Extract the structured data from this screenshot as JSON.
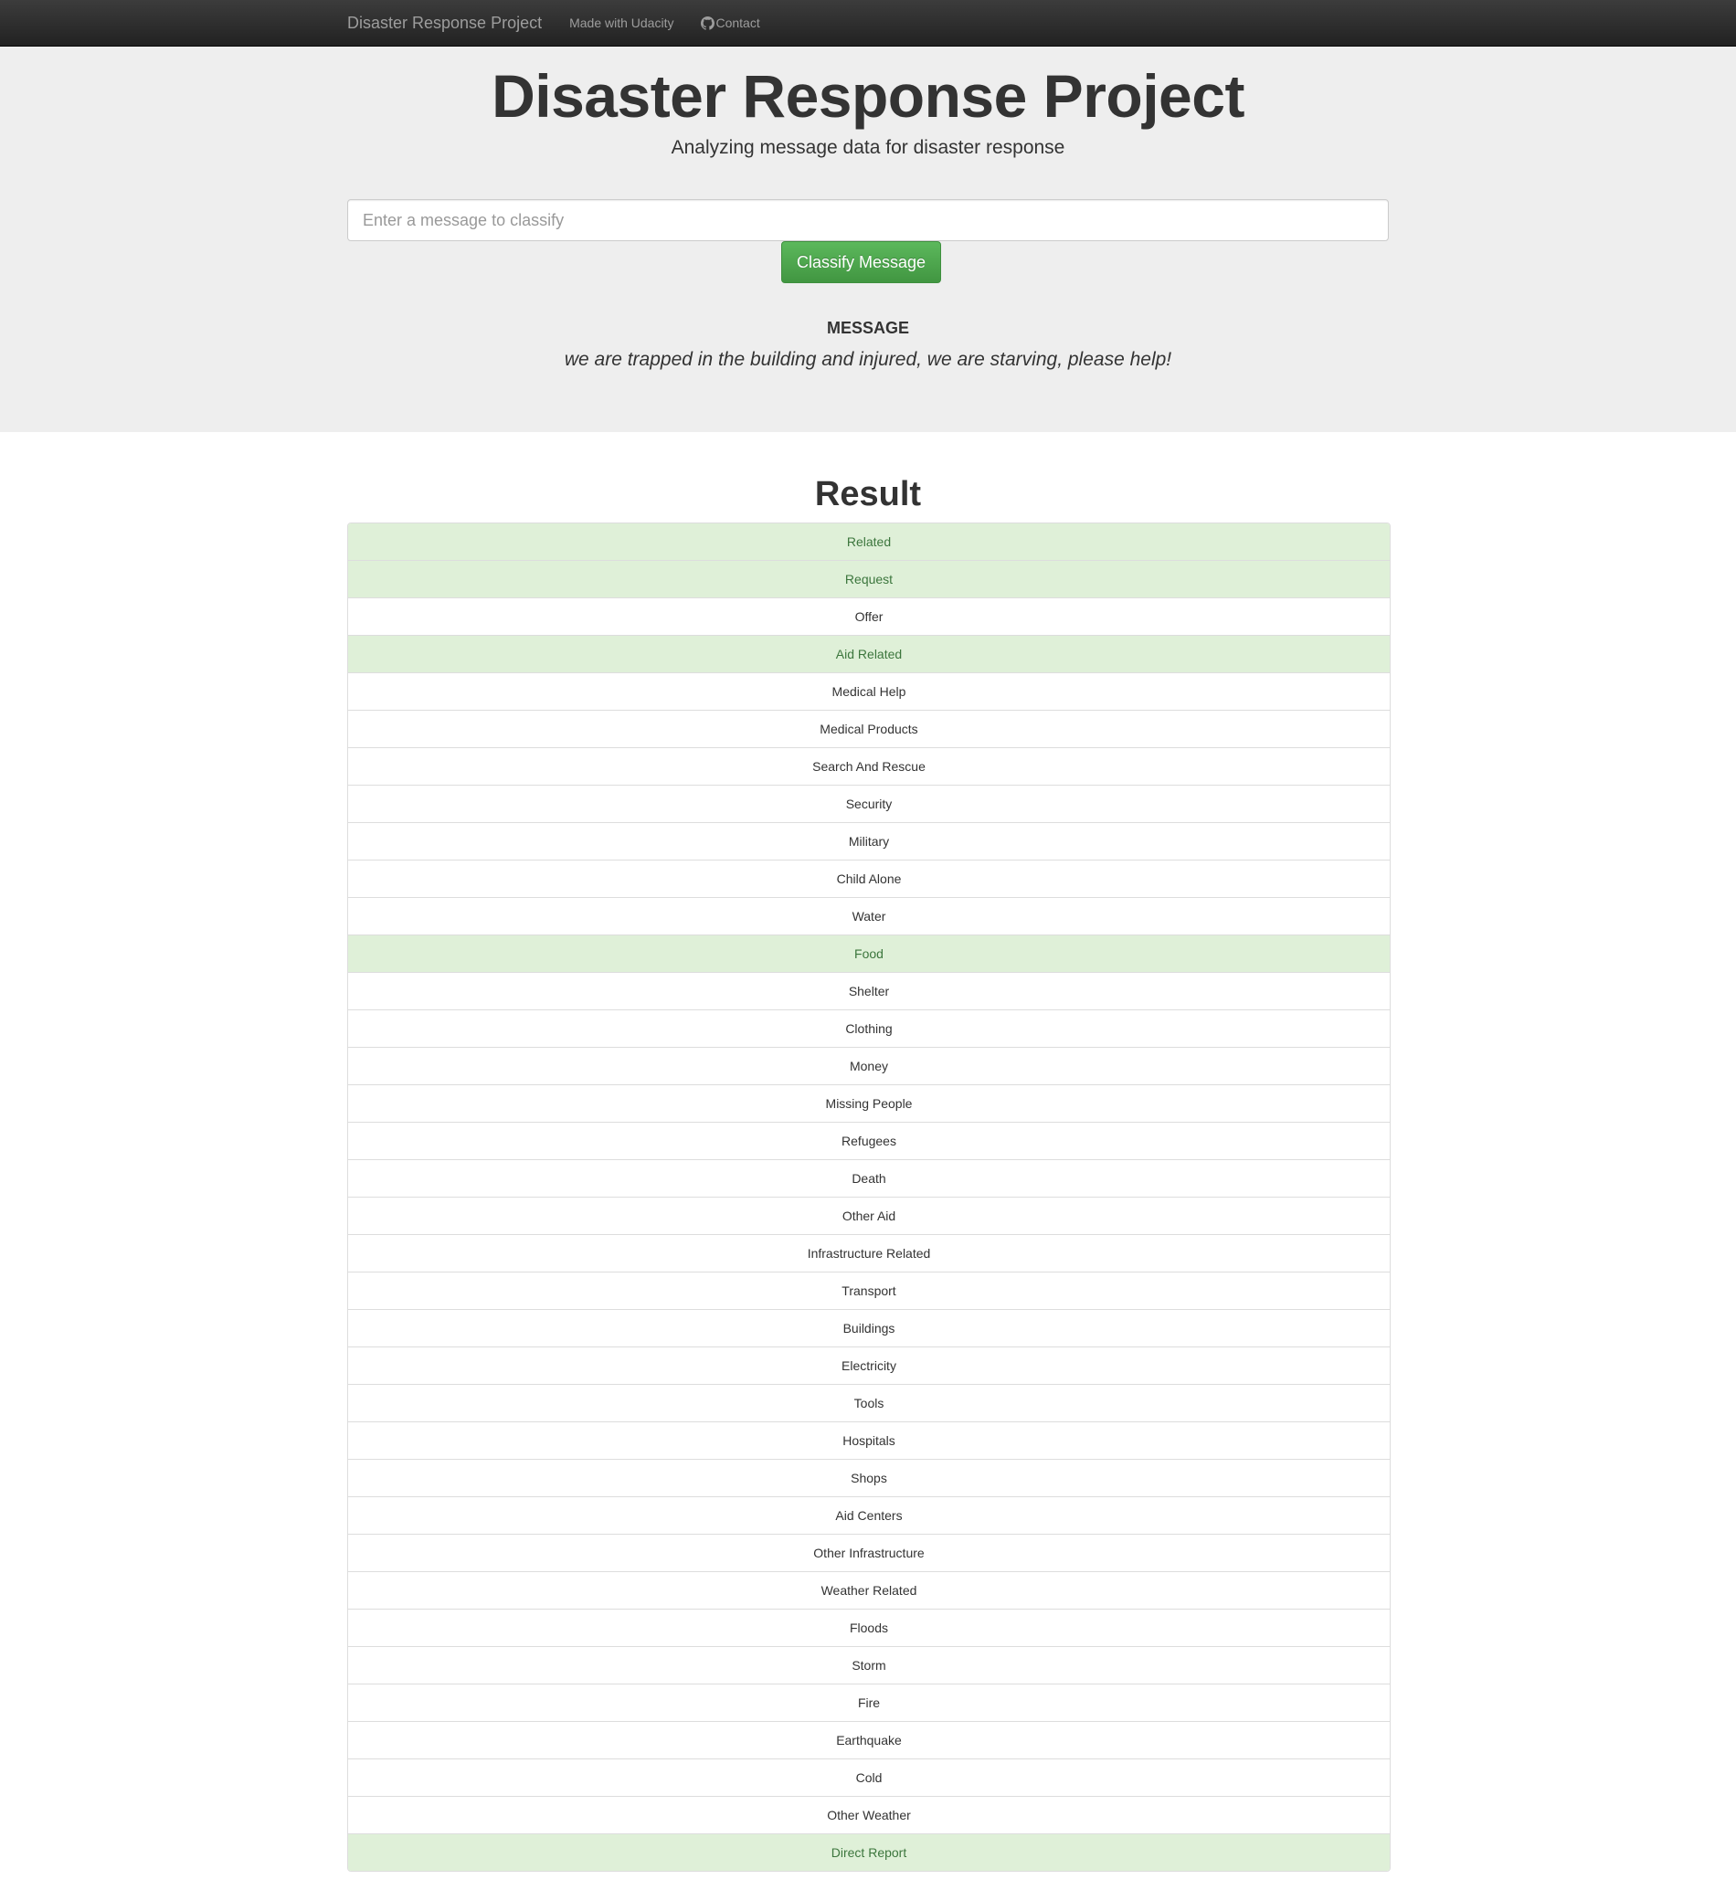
{
  "navbar": {
    "brand": "Disaster Response Project",
    "links": [
      {
        "label": "Made with Udacity",
        "icon": ""
      },
      {
        "label": "Contact",
        "icon": "github-icon"
      }
    ]
  },
  "header": {
    "title": "Disaster Response Project",
    "subtitle": "Analyzing message data for disaster response"
  },
  "form": {
    "input_placeholder": "Enter a message to classify",
    "input_value": "",
    "button_label": "Classify Message",
    "accent_color": "#5cb85c"
  },
  "message": {
    "heading": "MESSAGE",
    "text": "we are trapped in the building and injured, we are starving, please help!"
  },
  "result": {
    "title": "Result",
    "highlight_color": "#dff0d8",
    "categories": [
      {
        "label": "Related",
        "positive": true
      },
      {
        "label": "Request",
        "positive": true
      },
      {
        "label": "Offer",
        "positive": false
      },
      {
        "label": "Aid Related",
        "positive": true
      },
      {
        "label": "Medical Help",
        "positive": false
      },
      {
        "label": "Medical Products",
        "positive": false
      },
      {
        "label": "Search And Rescue",
        "positive": false
      },
      {
        "label": "Security",
        "positive": false
      },
      {
        "label": "Military",
        "positive": false
      },
      {
        "label": "Child Alone",
        "positive": false
      },
      {
        "label": "Water",
        "positive": false
      },
      {
        "label": "Food",
        "positive": true
      },
      {
        "label": "Shelter",
        "positive": false
      },
      {
        "label": "Clothing",
        "positive": false
      },
      {
        "label": "Money",
        "positive": false
      },
      {
        "label": "Missing People",
        "positive": false
      },
      {
        "label": "Refugees",
        "positive": false
      },
      {
        "label": "Death",
        "positive": false
      },
      {
        "label": "Other Aid",
        "positive": false
      },
      {
        "label": "Infrastructure Related",
        "positive": false
      },
      {
        "label": "Transport",
        "positive": false
      },
      {
        "label": "Buildings",
        "positive": false
      },
      {
        "label": "Electricity",
        "positive": false
      },
      {
        "label": "Tools",
        "positive": false
      },
      {
        "label": "Hospitals",
        "positive": false
      },
      {
        "label": "Shops",
        "positive": false
      },
      {
        "label": "Aid Centers",
        "positive": false
      },
      {
        "label": "Other Infrastructure",
        "positive": false
      },
      {
        "label": "Weather Related",
        "positive": false
      },
      {
        "label": "Floods",
        "positive": false
      },
      {
        "label": "Storm",
        "positive": false
      },
      {
        "label": "Fire",
        "positive": false
      },
      {
        "label": "Earthquake",
        "positive": false
      },
      {
        "label": "Cold",
        "positive": false
      },
      {
        "label": "Other Weather",
        "positive": false
      },
      {
        "label": "Direct Report",
        "positive": true
      }
    ]
  }
}
